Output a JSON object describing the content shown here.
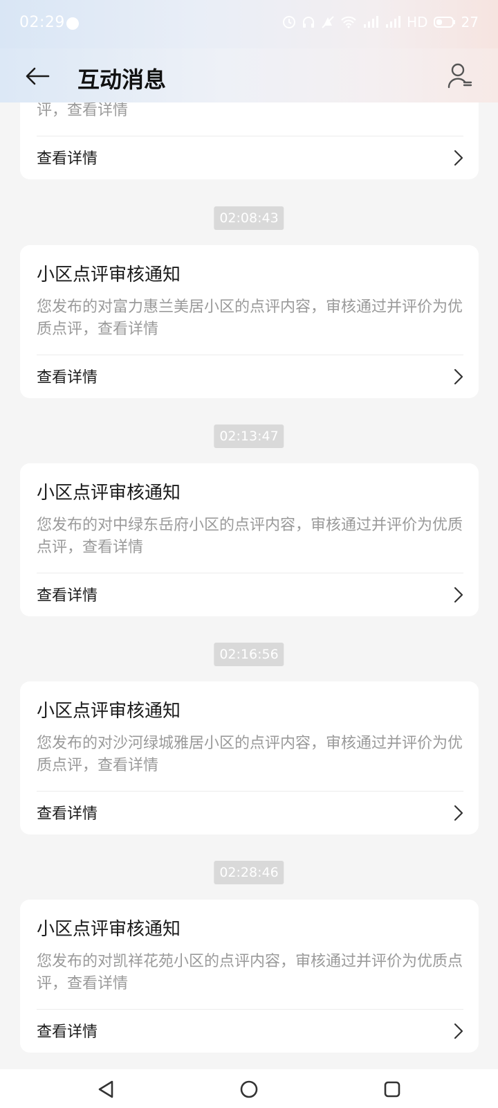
{
  "status_bar": {
    "time": "02:29",
    "battery_level": "27",
    "network_label": "HD"
  },
  "header": {
    "title": "互动消息"
  },
  "first_card_partial": {
    "body": "评，查看详情",
    "action_label": "查看详情"
  },
  "messages": [
    {
      "timestamp": "02:08:43",
      "title": "小区点评审核通知",
      "body": "您发布的对富力惠兰美居小区的点评内容，审核通过并评价为优质点评，查看详情",
      "action_label": "查看详情"
    },
    {
      "timestamp": "02:13:47",
      "title": "小区点评审核通知",
      "body": "您发布的对中绿东岳府小区的点评内容，审核通过并评价为优质点评，查看详情",
      "action_label": "查看详情"
    },
    {
      "timestamp": "02:16:56",
      "title": "小区点评审核通知",
      "body": "您发布的对沙河绿城雅居小区的点评内容，审核通过并评价为优质点评，查看详情",
      "action_label": "查看详情"
    },
    {
      "timestamp": "02:28:46",
      "title": "小区点评审核通知",
      "body": "您发布的对凯祥花苑小区的点评内容，审核通过并评价为优质点评，查看详情",
      "action_label": "查看详情"
    }
  ],
  "colors": {
    "background": "#f5f5f5",
    "card": "#ffffff",
    "body_text": "#9a9a9a",
    "timestamp_badge": "#d9d9d9"
  }
}
